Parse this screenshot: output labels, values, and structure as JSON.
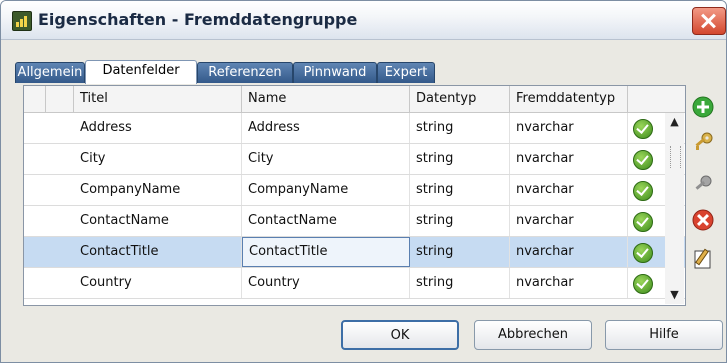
{
  "window": {
    "title": "Eigenschaften - Fremddatengruppe"
  },
  "tabs": [
    {
      "label": "Allgemein",
      "active": false
    },
    {
      "label": "Datenfelder",
      "active": true
    },
    {
      "label": "Referenzen",
      "active": false
    },
    {
      "label": "Pinnwand",
      "active": false
    },
    {
      "label": "Expert",
      "active": false
    }
  ],
  "grid": {
    "columns": [
      "Titel",
      "Name",
      "Datentyp",
      "Fremddatentyp"
    ],
    "rows": [
      {
        "titel": "Address",
        "name": "Address",
        "datentyp": "string",
        "fremd": "nvarchar",
        "status": "ok"
      },
      {
        "titel": "City",
        "name": "City",
        "datentyp": "string",
        "fremd": "nvarchar",
        "status": "ok"
      },
      {
        "titel": "CompanyName",
        "name": "CompanyName",
        "datentyp": "string",
        "fremd": "nvarchar",
        "status": "ok"
      },
      {
        "titel": "ContactName",
        "name": "ContactName",
        "datentyp": "string",
        "fremd": "nvarchar",
        "status": "ok"
      },
      {
        "titel": "ContactTitle",
        "name": "ContactTitle",
        "datentyp": "string",
        "fremd": "nvarchar",
        "status": "ok",
        "selected": true
      },
      {
        "titel": "Country",
        "name": "Country",
        "datentyp": "string",
        "fremd": "nvarchar",
        "status": "ok"
      }
    ]
  },
  "side_toolbar": [
    {
      "icon": "add-icon",
      "color": "#3aa83a"
    },
    {
      "icon": "key-icon",
      "color": "#c9a13a"
    },
    {
      "icon": "key-remove-icon",
      "color": "#9a9a9a"
    },
    {
      "icon": "delete-icon",
      "color": "#d9432f"
    },
    {
      "icon": "edit-icon",
      "color": "#d2a640"
    }
  ],
  "buttons": {
    "ok": "OK",
    "cancel": "Abbrechen",
    "help": "Hilfe"
  },
  "colors": {
    "tab_bg": "#3f6596",
    "selection": "#c6dbf2",
    "accent": "#3d6ea6"
  }
}
